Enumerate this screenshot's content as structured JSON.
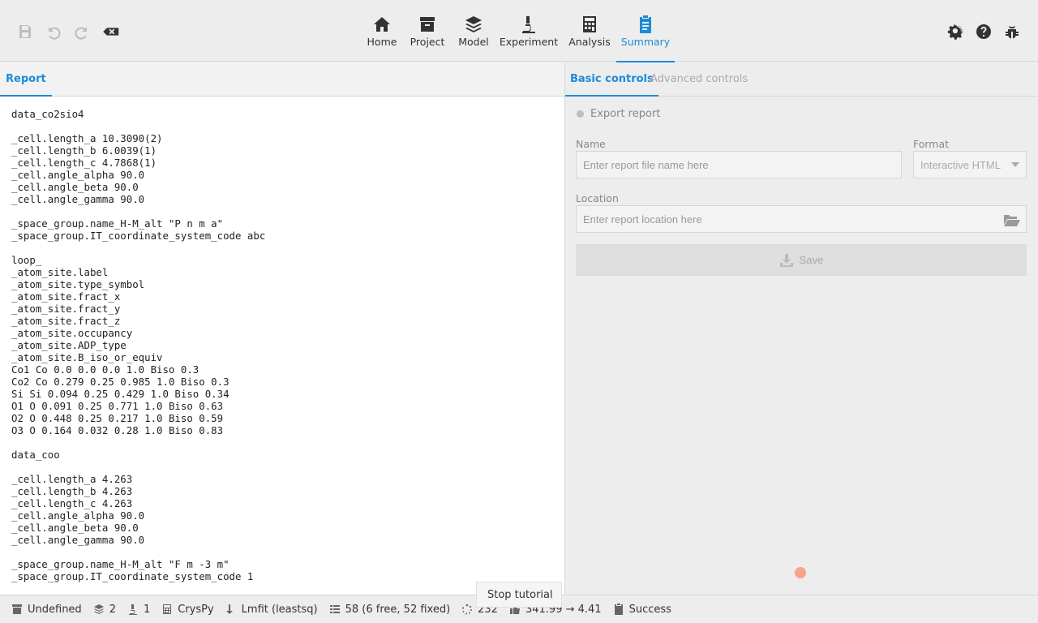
{
  "toolbar": {
    "left_icons": [
      "save-icon",
      "undo-icon",
      "redo-icon",
      "reset-icon"
    ],
    "right_icons": [
      "gear-icon",
      "help-icon",
      "bug-icon"
    ]
  },
  "nav_tabs": [
    {
      "label": "Home",
      "icon": "home-icon"
    },
    {
      "label": "Project",
      "icon": "archive-icon"
    },
    {
      "label": "Model",
      "icon": "layers-icon"
    },
    {
      "label": "Experiment",
      "icon": "microscope-icon"
    },
    {
      "label": "Analysis",
      "icon": "calculator-icon"
    },
    {
      "label": "Summary",
      "icon": "clipboard-icon",
      "active": true
    }
  ],
  "left_panel": {
    "tab_label": "Report",
    "report_text": "data_co2sio4\n\n_cell.length_a 10.3090(2)\n_cell.length_b 6.0039(1)\n_cell.length_c 4.7868(1)\n_cell.angle_alpha 90.0\n_cell.angle_beta 90.0\n_cell.angle_gamma 90.0\n\n_space_group.name_H-M_alt \"P n m a\"\n_space_group.IT_coordinate_system_code abc\n\nloop_\n_atom_site.label\n_atom_site.type_symbol\n_atom_site.fract_x\n_atom_site.fract_y\n_atom_site.fract_z\n_atom_site.occupancy\n_atom_site.ADP_type\n_atom_site.B_iso_or_equiv\nCo1 Co 0.0 0.0 0.0 1.0 Biso 0.3\nCo2 Co 0.279 0.25 0.985 1.0 Biso 0.3\nSi Si 0.094 0.25 0.429 1.0 Biso 0.34\nO1 O 0.091 0.25 0.771 1.0 Biso 0.63\nO2 O 0.448 0.25 0.217 1.0 Biso 0.59\nO3 O 0.164 0.032 0.28 1.0 Biso 0.83\n\ndata_coo\n\n_cell.length_a 4.263\n_cell.length_b 4.263\n_cell.length_c 4.263\n_cell.angle_alpha 90.0\n_cell.angle_beta 90.0\n_cell.angle_gamma 90.0\n\n_space_group.name_H-M_alt \"F m -3 m\"\n_space_group.IT_coordinate_system_code 1"
  },
  "right_panel": {
    "tabs": {
      "basic": "Basic controls",
      "advanced": "Advanced controls"
    },
    "export_label": "Export report",
    "name_label": "Name",
    "name_placeholder": "Enter report file name here",
    "format_label": "Format",
    "format_value": "Interactive HTML",
    "location_label": "Location",
    "location_placeholder": "Enter report location here",
    "save_label": "Save"
  },
  "tooltip": "Stop tutorial",
  "statusbar": {
    "project": "Undefined",
    "phases": "2",
    "experiments": "1",
    "calculator": "CrysPy",
    "minimizer": "Lmfit (leastsq)",
    "parameters": "58 (6 free, 52 fixed)",
    "iterations": "232",
    "chi_squared": "341.99 → 4.41",
    "status": "Success"
  },
  "colors": {
    "accent": "#1c8bd8",
    "marker": "#f7a38c"
  }
}
